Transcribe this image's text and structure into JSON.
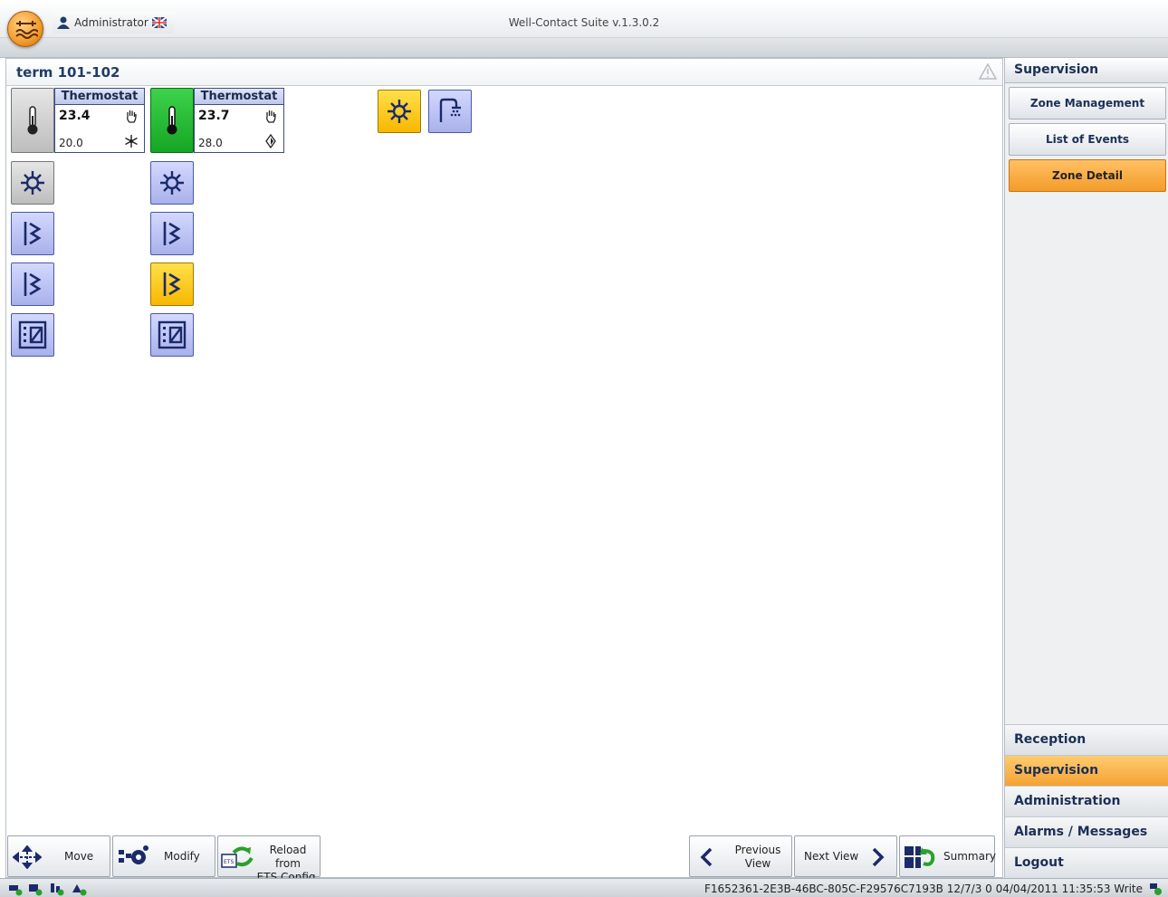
{
  "window": {
    "title": "Well-Contact Suite v.1.3.0.2",
    "user": "Administrator"
  },
  "zone": {
    "title": "term 101-102"
  },
  "thermostats": [
    {
      "label": "Thermostat",
      "current": "23.4",
      "setpoint": "20.0",
      "mode_icon": "hand-icon",
      "season_icon": "snowflake-icon",
      "state": "gray"
    },
    {
      "label": "Thermostat",
      "current": "23.7",
      "setpoint": "28.0",
      "mode_icon": "hand-icon",
      "season_icon": "sun-icon",
      "state": "green"
    }
  ],
  "toolbar": {
    "move": "Move",
    "modify": "Modify",
    "reload_line1": "Reload from",
    "reload_line2": "ETS Config.",
    "prev_line1": "Previous",
    "prev_line2": "View",
    "next": "Next View",
    "summary": "Summary"
  },
  "sidebar": {
    "title": "Supervision",
    "buttons": [
      "Zone Management",
      "List of Events",
      "Zone Detail"
    ],
    "active_button": "Zone Detail",
    "nav": [
      "Reception",
      "Supervision",
      "Administration",
      "Alarms / Messages",
      "Logout"
    ],
    "active_nav": "Supervision"
  },
  "status": {
    "text": "F1652361-2E3B-46BC-805C-F29576C7193B 12/7/3 0 04/04/2011 11:35:53 Write"
  },
  "colors": {
    "accent": "#f4a232",
    "tile_blue": "#a9b1ea",
    "tile_yellow": "#f7b800",
    "tile_green": "#15a625"
  }
}
